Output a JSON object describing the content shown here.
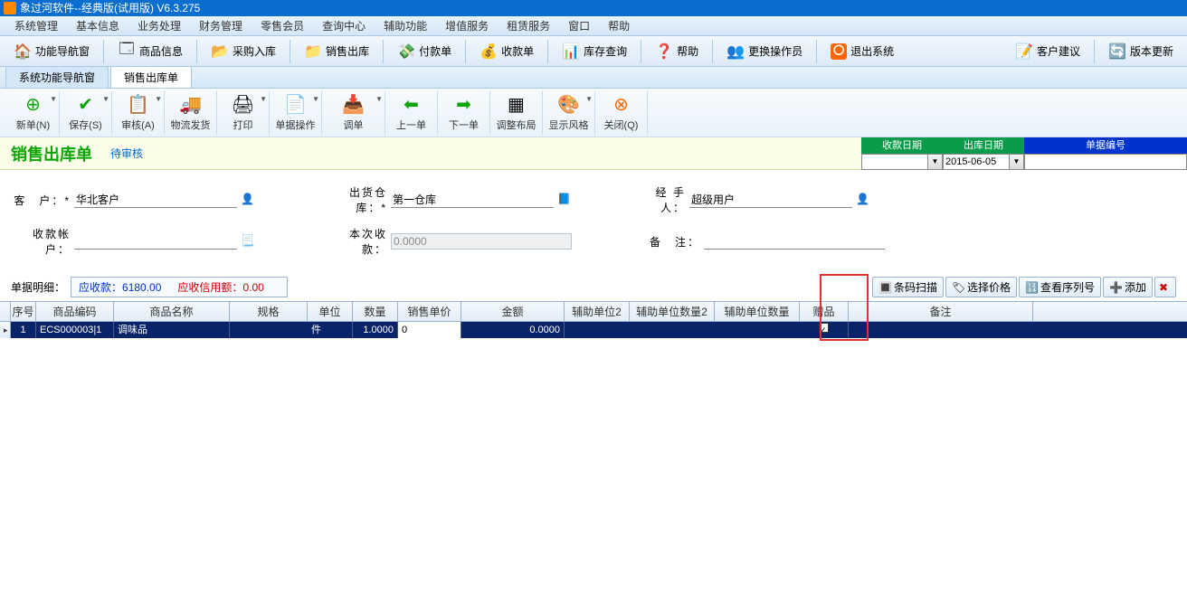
{
  "title": "象过河软件--经典版(试用版)  V6.3.275",
  "menubar": [
    "系统管理",
    "基本信息",
    "业务处理",
    "财务管理",
    "零售会员",
    "查询中心",
    "辅助功能",
    "增值服务",
    "租赁服务",
    "窗口",
    "帮助"
  ],
  "maintoolbar": [
    {
      "label": "功能导航窗",
      "icon": "home"
    },
    {
      "label": "商品信息",
      "icon": "grid"
    },
    {
      "label": "采购入库",
      "icon": "folder-in"
    },
    {
      "label": "销售出库",
      "icon": "folder-out"
    },
    {
      "label": "付款单",
      "icon": "pay-out"
    },
    {
      "label": "收款单",
      "icon": "pay-in"
    },
    {
      "label": "库存查询",
      "icon": "stock"
    },
    {
      "label": "帮助",
      "icon": "help"
    },
    {
      "label": "更换操作员",
      "icon": "user-switch"
    },
    {
      "label": "退出系统",
      "icon": "quit"
    },
    {
      "label": "客户建议",
      "icon": "note"
    },
    {
      "label": "版本更新",
      "icon": "refresh"
    }
  ],
  "tabs": [
    {
      "label": "系统功能导航窗",
      "active": false
    },
    {
      "label": "销售出库单",
      "active": true
    }
  ],
  "subtoolbar": [
    {
      "label": "新单(N)",
      "icon": "new",
      "dd": true
    },
    {
      "label": "保存(S)",
      "icon": "save",
      "dd": true
    },
    {
      "label": "审核(A)",
      "icon": "audit",
      "dd": true
    },
    {
      "label": "物流发货",
      "icon": "ship",
      "dd": false
    },
    {
      "label": "打印",
      "icon": "print",
      "dd": true
    },
    {
      "label": "单据操作",
      "icon": "docop",
      "dd": true
    },
    {
      "label": "调单",
      "icon": "fetch",
      "dd": true
    },
    {
      "label": "上一单",
      "icon": "prev",
      "dd": false
    },
    {
      "label": "下一单",
      "icon": "next",
      "dd": false
    },
    {
      "label": "调整布局",
      "icon": "layout",
      "dd": false
    },
    {
      "label": "显示风格",
      "icon": "style",
      "dd": true
    },
    {
      "label": "关闭(Q)",
      "icon": "close",
      "dd": false
    }
  ],
  "doc": {
    "title": "销售出库单",
    "status": "待审核",
    "datecols": [
      {
        "label": "收款日期",
        "cls": "hdgreen",
        "value": ""
      },
      {
        "label": "出库日期",
        "cls": "hdgreen",
        "value": "2015-06-05"
      },
      {
        "label": "单据编号",
        "cls": "hdblue",
        "value": ""
      }
    ]
  },
  "form": {
    "customer_label": "客　户：*",
    "customer": "华北客户",
    "warehouse_label": "出货仓库：*",
    "warehouse": "第一仓库",
    "handler_label": "经 手 人：",
    "handler": "超级用户",
    "acct_label": "收款帐户：",
    "acct": "",
    "thispay_label": "本次收款：",
    "thispay": "0.0000",
    "remark_label": "备　注：",
    "remark": ""
  },
  "detail": {
    "label": "单据明细：",
    "receivable_label": "应收款：",
    "receivable": "6180.00",
    "credit_label": "应收信用额：",
    "credit": "0.00"
  },
  "rightbtns": [
    {
      "label": "条码扫描",
      "icon": "barcode"
    },
    {
      "label": "选择价格",
      "icon": "price"
    },
    {
      "label": "查看序列号",
      "icon": "serial"
    },
    {
      "label": "添加",
      "icon": "add"
    }
  ],
  "grid": {
    "headers": [
      "序号",
      "商品编码",
      "商品名称",
      "规格",
      "单位",
      "数量",
      "销售单价",
      "金额",
      "辅助单位2",
      "辅助单位数量2",
      "辅助单位数量",
      "赠品",
      "备注"
    ],
    "row": {
      "seq": "1",
      "code": "ECS000003|1",
      "name": "调味品",
      "spec": "",
      "unit": "件",
      "qty": "1.0000",
      "price": "0",
      "amount": "0.0000",
      "aux2": "",
      "auxqty2": "",
      "auxqty": "",
      "gift": true,
      "remark": ""
    }
  }
}
